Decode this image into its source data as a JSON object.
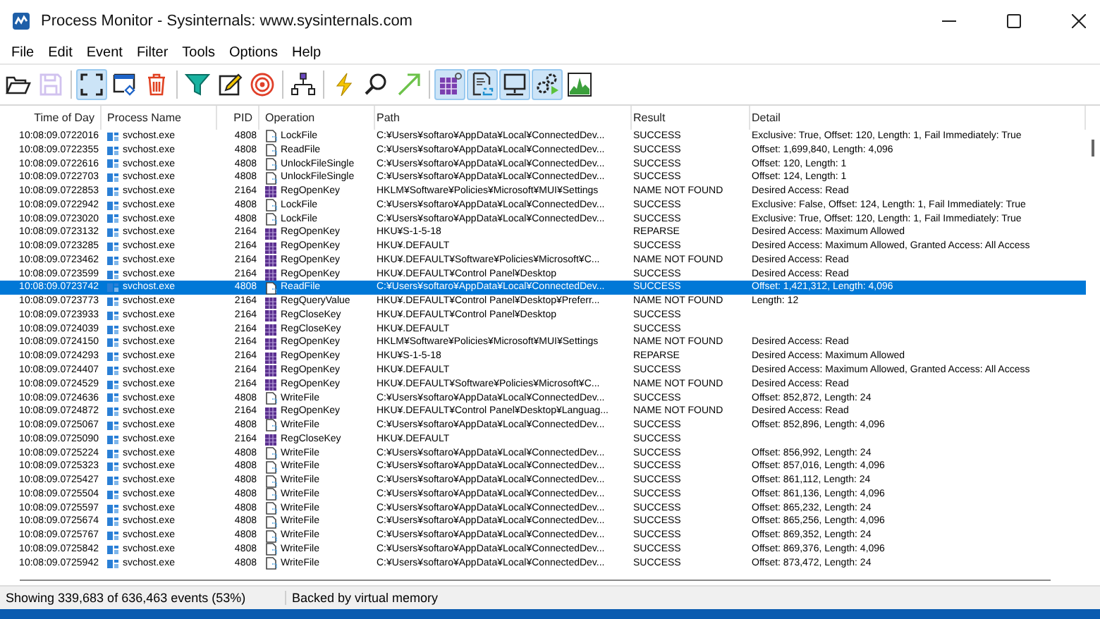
{
  "window": {
    "title": "Process Monitor - Sysinternals: www.sysinternals.com"
  },
  "menu": [
    "File",
    "Edit",
    "Event",
    "Filter",
    "Tools",
    "Options",
    "Help"
  ],
  "toolbar": [
    [
      {
        "kind": "open",
        "active": false,
        "disabled": false
      },
      {
        "kind": "save",
        "active": false,
        "disabled": true
      }
    ],
    [
      {
        "kind": "capture",
        "active": true,
        "disabled": false
      },
      {
        "kind": "autoscroll",
        "active": false,
        "disabled": false
      },
      {
        "kind": "clear",
        "active": false,
        "disabled": false
      }
    ],
    [
      {
        "kind": "filter",
        "active": false,
        "disabled": false
      },
      {
        "kind": "highlight",
        "active": false,
        "disabled": false
      },
      {
        "kind": "include",
        "active": false,
        "disabled": false
      }
    ],
    [
      {
        "kind": "tree",
        "active": false,
        "disabled": false
      }
    ],
    [
      {
        "kind": "events",
        "active": false,
        "disabled": false
      },
      {
        "kind": "find",
        "active": false,
        "disabled": false
      },
      {
        "kind": "jump",
        "active": false,
        "disabled": false
      }
    ],
    [
      {
        "kind": "registry",
        "active": true,
        "disabled": false
      },
      {
        "kind": "filesystem",
        "active": true,
        "disabled": false
      },
      {
        "kind": "network",
        "active": true,
        "disabled": false
      },
      {
        "kind": "process",
        "active": true,
        "disabled": false
      },
      {
        "kind": "profiling",
        "active": false,
        "disabled": false
      }
    ]
  ],
  "table": {
    "columns": [
      "Time of Day",
      "Process Name",
      "PID",
      "Operation",
      "Path",
      "Result",
      "Detail"
    ],
    "rows": [
      {
        "time": "10:08:09.0722016",
        "process": "svchost.exe",
        "pid": "4808",
        "kind": "file",
        "operation": "LockFile",
        "path": "C:¥Users¥softaro¥AppData¥Local¥ConnectedDev...",
        "result": "SUCCESS",
        "detail": "Exclusive: True, Offset: 120, Length: 1, Fail Immediately: True",
        "selected": false
      },
      {
        "time": "10:08:09.0722355",
        "process": "svchost.exe",
        "pid": "4808",
        "kind": "file",
        "operation": "ReadFile",
        "path": "C:¥Users¥softaro¥AppData¥Local¥ConnectedDev...",
        "result": "SUCCESS",
        "detail": "Offset: 1,699,840, Length: 4,096",
        "selected": false
      },
      {
        "time": "10:08:09.0722616",
        "process": "svchost.exe",
        "pid": "4808",
        "kind": "file",
        "operation": "UnlockFileSingle",
        "path": "C:¥Users¥softaro¥AppData¥Local¥ConnectedDev...",
        "result": "SUCCESS",
        "detail": "Offset: 120, Length: 1",
        "selected": false
      },
      {
        "time": "10:08:09.0722703",
        "process": "svchost.exe",
        "pid": "4808",
        "kind": "file",
        "operation": "UnlockFileSingle",
        "path": "C:¥Users¥softaro¥AppData¥Local¥ConnectedDev...",
        "result": "SUCCESS",
        "detail": "Offset: 124, Length: 1",
        "selected": false
      },
      {
        "time": "10:08:09.0722853",
        "process": "svchost.exe",
        "pid": "2164",
        "kind": "registry",
        "operation": "RegOpenKey",
        "path": "HKLM¥Software¥Policies¥Microsoft¥MUI¥Settings",
        "result": "NAME NOT FOUND",
        "detail": "Desired Access: Read",
        "selected": false
      },
      {
        "time": "10:08:09.0722942",
        "process": "svchost.exe",
        "pid": "4808",
        "kind": "file",
        "operation": "LockFile",
        "path": "C:¥Users¥softaro¥AppData¥Local¥ConnectedDev...",
        "result": "SUCCESS",
        "detail": "Exclusive: False, Offset: 124, Length: 1, Fail Immediately: True",
        "selected": false
      },
      {
        "time": "10:08:09.0723020",
        "process": "svchost.exe",
        "pid": "4808",
        "kind": "file",
        "operation": "LockFile",
        "path": "C:¥Users¥softaro¥AppData¥Local¥ConnectedDev...",
        "result": "SUCCESS",
        "detail": "Exclusive: True, Offset: 120, Length: 1, Fail Immediately: True",
        "selected": false
      },
      {
        "time": "10:08:09.0723132",
        "process": "svchost.exe",
        "pid": "2164",
        "kind": "registry",
        "operation": "RegOpenKey",
        "path": "HKU¥S-1-5-18",
        "result": "REPARSE",
        "detail": "Desired Access: Maximum Allowed",
        "selected": false
      },
      {
        "time": "10:08:09.0723285",
        "process": "svchost.exe",
        "pid": "2164",
        "kind": "registry",
        "operation": "RegOpenKey",
        "path": "HKU¥.DEFAULT",
        "result": "SUCCESS",
        "detail": "Desired Access: Maximum Allowed, Granted Access: All Access",
        "selected": false
      },
      {
        "time": "10:08:09.0723462",
        "process": "svchost.exe",
        "pid": "2164",
        "kind": "registry",
        "operation": "RegOpenKey",
        "path": "HKU¥.DEFAULT¥Software¥Policies¥Microsoft¥C...",
        "result": "NAME NOT FOUND",
        "detail": "Desired Access: Read",
        "selected": false
      },
      {
        "time": "10:08:09.0723599",
        "process": "svchost.exe",
        "pid": "2164",
        "kind": "registry",
        "operation": "RegOpenKey",
        "path": "HKU¥.DEFAULT¥Control Panel¥Desktop",
        "result": "SUCCESS",
        "detail": "Desired Access: Read",
        "selected": false
      },
      {
        "time": "10:08:09.0723742",
        "process": "svchost.exe",
        "pid": "4808",
        "kind": "file",
        "operation": "ReadFile",
        "path": "C:¥Users¥softaro¥AppData¥Local¥ConnectedDev...",
        "result": "SUCCESS",
        "detail": "Offset: 1,421,312, Length: 4,096",
        "selected": true
      },
      {
        "time": "10:08:09.0723773",
        "process": "svchost.exe",
        "pid": "2164",
        "kind": "registry",
        "operation": "RegQueryValue",
        "path": "HKU¥.DEFAULT¥Control Panel¥Desktop¥Preferr...",
        "result": "NAME NOT FOUND",
        "detail": "Length: 12",
        "selected": false
      },
      {
        "time": "10:08:09.0723933",
        "process": "svchost.exe",
        "pid": "2164",
        "kind": "registry",
        "operation": "RegCloseKey",
        "path": "HKU¥.DEFAULT¥Control Panel¥Desktop",
        "result": "SUCCESS",
        "selected": false
      },
      {
        "time": "10:08:09.0724039",
        "process": "svchost.exe",
        "pid": "2164",
        "kind": "registry",
        "operation": "RegCloseKey",
        "path": "HKU¥.DEFAULT",
        "result": "SUCCESS",
        "selected": false
      },
      {
        "time": "10:08:09.0724150",
        "process": "svchost.exe",
        "pid": "2164",
        "kind": "registry",
        "operation": "RegOpenKey",
        "path": "HKLM¥Software¥Policies¥Microsoft¥MUI¥Settings",
        "result": "NAME NOT FOUND",
        "detail": "Desired Access: Read",
        "selected": false
      },
      {
        "time": "10:08:09.0724293",
        "process": "svchost.exe",
        "pid": "2164",
        "kind": "registry",
        "operation": "RegOpenKey",
        "path": "HKU¥S-1-5-18",
        "result": "REPARSE",
        "detail": "Desired Access: Maximum Allowed",
        "selected": false
      },
      {
        "time": "10:08:09.0724407",
        "process": "svchost.exe",
        "pid": "2164",
        "kind": "registry",
        "operation": "RegOpenKey",
        "path": "HKU¥.DEFAULT",
        "result": "SUCCESS",
        "detail": "Desired Access: Maximum Allowed, Granted Access: All Access",
        "selected": false
      },
      {
        "time": "10:08:09.0724529",
        "process": "svchost.exe",
        "pid": "2164",
        "kind": "registry",
        "operation": "RegOpenKey",
        "path": "HKU¥.DEFAULT¥Software¥Policies¥Microsoft¥C...",
        "result": "NAME NOT FOUND",
        "detail": "Desired Access: Read",
        "selected": false
      },
      {
        "time": "10:08:09.0724636",
        "process": "svchost.exe",
        "pid": "4808",
        "kind": "file",
        "operation": "WriteFile",
        "path": "C:¥Users¥softaro¥AppData¥Local¥ConnectedDev...",
        "result": "SUCCESS",
        "detail": "Offset: 852,872, Length: 24",
        "selected": false
      },
      {
        "time": "10:08:09.0724872",
        "process": "svchost.exe",
        "pid": "2164",
        "kind": "registry",
        "operation": "RegOpenKey",
        "path": "HKU¥.DEFAULT¥Control Panel¥Desktop¥Languag...",
        "result": "NAME NOT FOUND",
        "detail": "Desired Access: Read",
        "selected": false
      },
      {
        "time": "10:08:09.0725067",
        "process": "svchost.exe",
        "pid": "4808",
        "kind": "file",
        "operation": "WriteFile",
        "path": "C:¥Users¥softaro¥AppData¥Local¥ConnectedDev...",
        "result": "SUCCESS",
        "detail": "Offset: 852,896, Length: 4,096",
        "selected": false
      },
      {
        "time": "10:08:09.0725090",
        "process": "svchost.exe",
        "pid": "2164",
        "kind": "registry",
        "operation": "RegCloseKey",
        "path": "HKU¥.DEFAULT",
        "result": "SUCCESS",
        "selected": false
      },
      {
        "time": "10:08:09.0725224",
        "process": "svchost.exe",
        "pid": "4808",
        "kind": "file",
        "operation": "WriteFile",
        "path": "C:¥Users¥softaro¥AppData¥Local¥ConnectedDev...",
        "result": "SUCCESS",
        "detail": "Offset: 856,992, Length: 24",
        "selected": false
      },
      {
        "time": "10:08:09.0725323",
        "process": "svchost.exe",
        "pid": "4808",
        "kind": "file",
        "operation": "WriteFile",
        "path": "C:¥Users¥softaro¥AppData¥Local¥ConnectedDev...",
        "result": "SUCCESS",
        "detail": "Offset: 857,016, Length: 4,096",
        "selected": false
      },
      {
        "time": "10:08:09.0725427",
        "process": "svchost.exe",
        "pid": "4808",
        "kind": "file",
        "operation": "WriteFile",
        "path": "C:¥Users¥softaro¥AppData¥Local¥ConnectedDev...",
        "result": "SUCCESS",
        "detail": "Offset: 861,112, Length: 24",
        "selected": false
      },
      {
        "time": "10:08:09.0725504",
        "process": "svchost.exe",
        "pid": "4808",
        "kind": "file",
        "operation": "WriteFile",
        "path": "C:¥Users¥softaro¥AppData¥Local¥ConnectedDev...",
        "result": "SUCCESS",
        "detail": "Offset: 861,136, Length: 4,096",
        "selected": false
      },
      {
        "time": "10:08:09.0725597",
        "process": "svchost.exe",
        "pid": "4808",
        "kind": "file",
        "operation": "WriteFile",
        "path": "C:¥Users¥softaro¥AppData¥Local¥ConnectedDev...",
        "result": "SUCCESS",
        "detail": "Offset: 865,232, Length: 24",
        "selected": false
      },
      {
        "time": "10:08:09.0725674",
        "process": "svchost.exe",
        "pid": "4808",
        "kind": "file",
        "operation": "WriteFile",
        "path": "C:¥Users¥softaro¥AppData¥Local¥ConnectedDev...",
        "result": "SUCCESS",
        "detail": "Offset: 865,256, Length: 4,096",
        "selected": false
      },
      {
        "time": "10:08:09.0725767",
        "process": "svchost.exe",
        "pid": "4808",
        "kind": "file",
        "operation": "WriteFile",
        "path": "C:¥Users¥softaro¥AppData¥Local¥ConnectedDev...",
        "result": "SUCCESS",
        "detail": "Offset: 869,352, Length: 24",
        "selected": false
      },
      {
        "time": "10:08:09.0725842",
        "process": "svchost.exe",
        "pid": "4808",
        "kind": "file",
        "operation": "WriteFile",
        "path": "C:¥Users¥softaro¥AppData¥Local¥ConnectedDev...",
        "result": "SUCCESS",
        "detail": "Offset: 869,376, Length: 4,096",
        "selected": false
      },
      {
        "time": "10:08:09.0725942",
        "process": "svchost.exe",
        "pid": "4808",
        "kind": "file",
        "operation": "WriteFile",
        "path": "C:¥Users¥softaro¥AppData¥Local¥ConnectedDev...",
        "result": "SUCCESS",
        "detail": "Offset: 873,472, Length: 24",
        "selected": false
      }
    ]
  },
  "status_bar": {
    "events": "Showing 339,683 of 636,463 events (53%)",
    "memory": "Backed by virtual memory"
  }
}
